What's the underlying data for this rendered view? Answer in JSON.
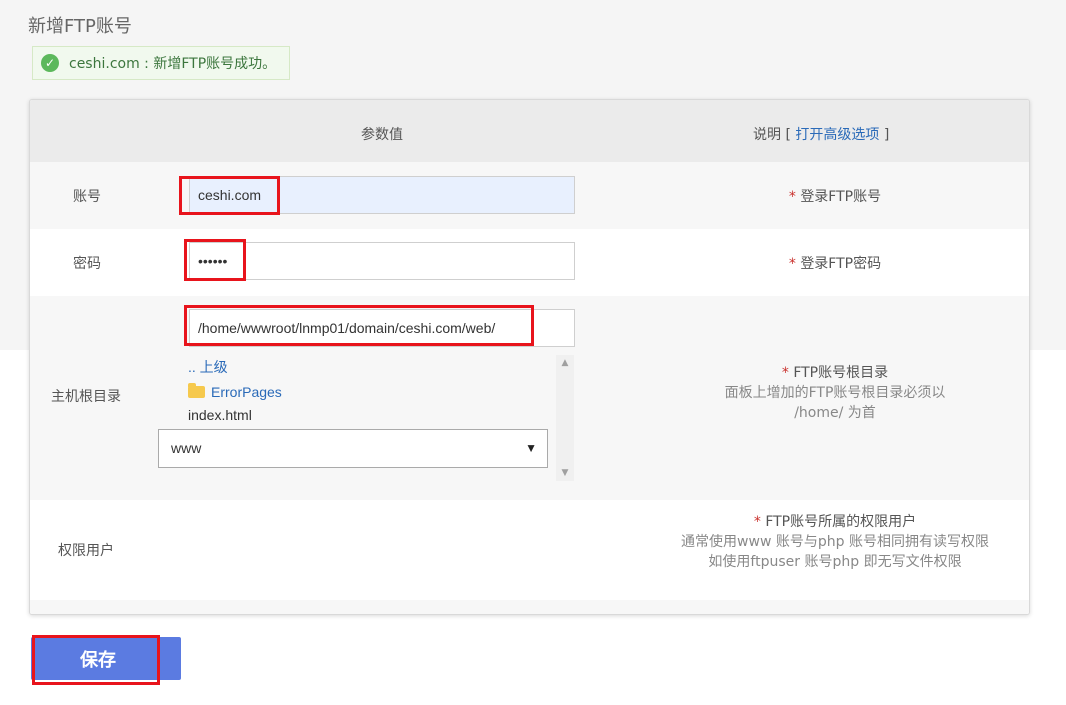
{
  "page_title": "新增FTP账号",
  "alert": {
    "message": "ceshi.com : 新增FTP账号成功。"
  },
  "table": {
    "col_value": "参数值",
    "col_desc_prefix": "说明 [",
    "col_desc_link": "打开高级选项",
    "col_desc_suffix": "]"
  },
  "account": {
    "label": "账号",
    "value": "ceshi.com",
    "star": "*",
    "desc": "登录FTP账号"
  },
  "password": {
    "label": "密码",
    "value": "••••••",
    "star": "*",
    "desc": "登录FTP密码"
  },
  "root_dir": {
    "label": "主机根目录",
    "value": "/home/wwwroot/lnmp01/domain/ceshi.com/web/",
    "files": {
      "parent": ".. 上级",
      "folder": "ErrorPages",
      "file": "index.html"
    },
    "star": "*",
    "desc": "FTP账号根目录",
    "note1": "面板上增加的FTP账号根目录必须以",
    "note2": "/home/ 为首"
  },
  "perm_user": {
    "label": "权限用户",
    "selected": "www",
    "star": "*",
    "desc": "FTP账号所属的权限用户",
    "note1": "通常使用www 账号与php 账号相同拥有读写权限",
    "note2": "如使用ftpuser 账号php 即无写文件权限"
  },
  "save_label": "保存",
  "colors": {
    "highlight": "#e8141c",
    "button": "#5b7be1",
    "star": "#c9302c",
    "link": "#2a6ab8"
  }
}
